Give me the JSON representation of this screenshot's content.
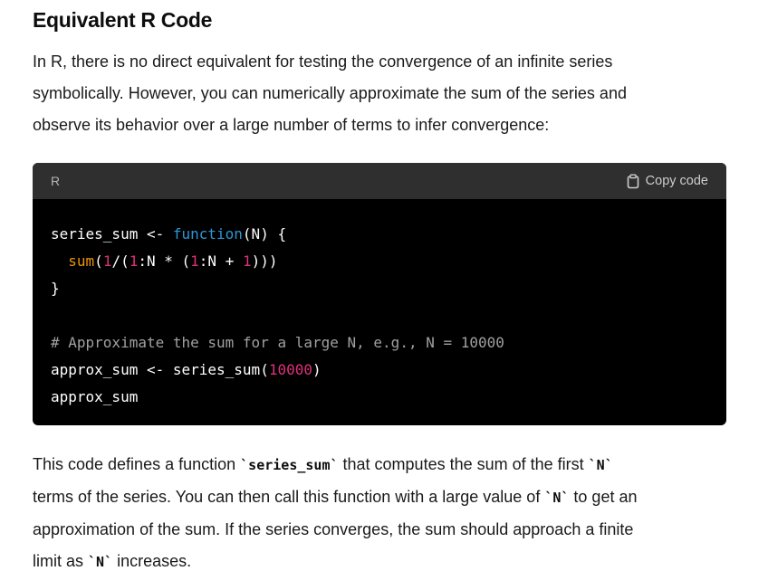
{
  "heading": "Equivalent R Code",
  "intro": {
    "line1": "In R, there is no direct equivalent for testing the convergence of an infinite series",
    "line2": "symbolically. However, you can numerically approximate the sum of the series and",
    "line3": "observe its behavior over a large number of terms to infer convergence:"
  },
  "code_block": {
    "language": "R",
    "copy_label": "Copy code",
    "lines": {
      "l1": {
        "a": "series_sum <- ",
        "b": "function",
        "c": "(N) {"
      },
      "l2": {
        "indent": "  ",
        "sum": "sum",
        "p1": "(",
        "n1": "1",
        "p2": "/(",
        "n2": "1",
        "p3": ":N * (",
        "n3": "1",
        "p4": ":N + ",
        "n4": "1",
        "p5": ")))"
      },
      "l3": "}",
      "l5": "# Approximate the sum for a large N, e.g., N = 10000",
      "l6": {
        "a": "approx_sum <- series_sum(",
        "n": "10000",
        "b": ")"
      },
      "l7": "approx_sum"
    }
  },
  "outro": {
    "l1_a": "This code defines a function ",
    "l1_code": "`series_sum`",
    "l1_b": " that computes the sum of the first ",
    "l1_code2": "`N`",
    "l2_a": "terms of the series. You can then call this function with a large value of ",
    "l2_code": "`N`",
    "l2_b": " to get an",
    "l3": "approximation of the sum. If the series converges, the sum should approach a finite",
    "l4_a": "limit as ",
    "l4_code": "`N`",
    "l4_b": " increases."
  }
}
